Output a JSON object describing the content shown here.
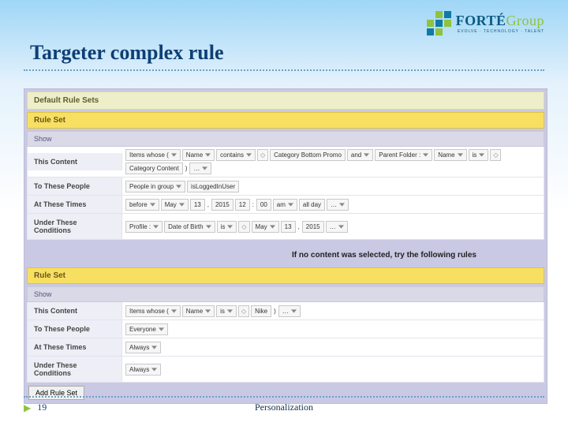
{
  "header": {
    "title": "Targeter complex rule",
    "logo_brand": "FORTÉ",
    "logo_suffix": "Group",
    "logo_tag": "EVOLVE · TECHNOLOGY · TALENT"
  },
  "panel": {
    "default_header": "Default Rule Sets",
    "ruleset_header": "Rule Set",
    "show_header": "Show",
    "labels": {
      "this_content": "This Content",
      "to_these_people": "To These People",
      "at_these_times": "At These Times",
      "under_conditions": "Under These Conditions"
    },
    "ruleset1": {
      "content": {
        "prefix": "Items whose (",
        "field1": "Name",
        "op1": "contains",
        "val1": "Category Bottom Promo",
        "conj": "and",
        "field2": "Parent Folder :",
        "field3": "Name",
        "op2": "is",
        "val2": "Category Content",
        "close": ")",
        "ellipsis": "…"
      },
      "people": {
        "prefix": "People in group",
        "val": "isLoggedInUser"
      },
      "times": {
        "op": "before",
        "month": "May",
        "day": "13",
        "comma": ",",
        "year": "2015",
        "hour": "12",
        "colon": ":",
        "min": "00",
        "ampm": "am",
        "span": "all day",
        "ellipsis": "…"
      },
      "conditions": {
        "prefix": "Profile :",
        "field": "Date of Birth",
        "op": "is",
        "month": "May",
        "day": "13",
        "comma": ",",
        "year": "2015",
        "ellipsis": "…"
      }
    },
    "fallback_text": "If no content was selected, try the following rules",
    "ruleset2": {
      "content": {
        "prefix": "Items whose (",
        "field1": "Name",
        "op1": "is",
        "val1": "Nike",
        "close": ")",
        "ellipsis": "…"
      },
      "people": {
        "val": "Everyone"
      },
      "times": {
        "val": "Always"
      },
      "conditions": {
        "val": "Always"
      }
    },
    "add_btn": "Add Rule Set"
  },
  "footer": {
    "page": "19",
    "label": "Personalization"
  }
}
